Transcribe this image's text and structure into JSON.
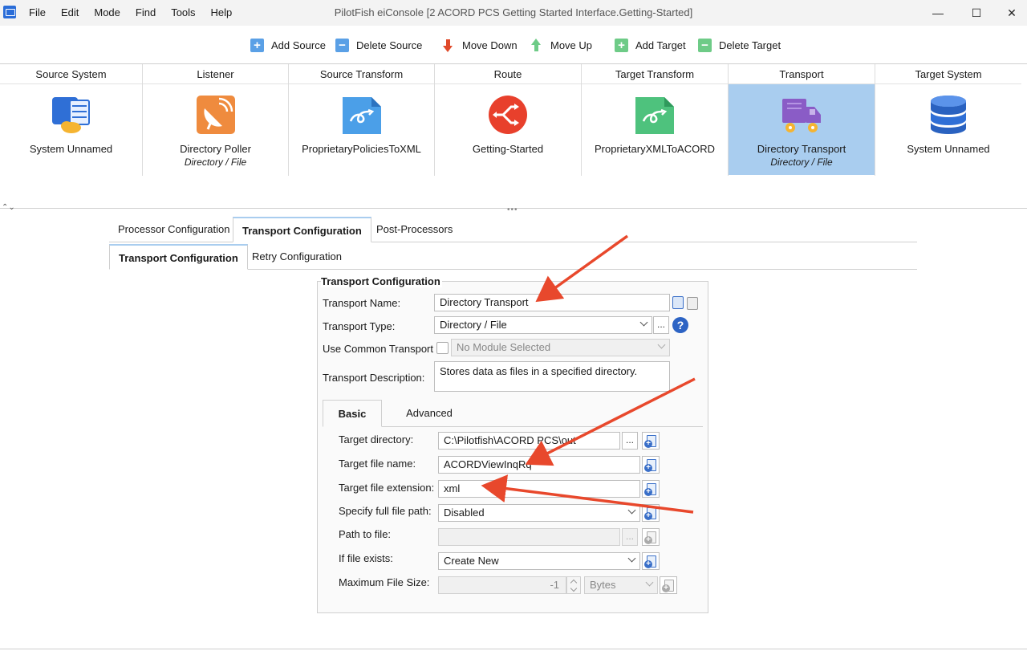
{
  "window": {
    "title": "PilotFish eiConsole [2 ACORD PCS Getting Started Interface.Getting-Started]",
    "minimize": "—",
    "maximize": "☐",
    "close": "✕"
  },
  "menu": [
    "File",
    "Edit",
    "Mode",
    "Find",
    "Tools",
    "Help"
  ],
  "toolbar": {
    "add_source": "Add Source",
    "delete_source": "Delete Source",
    "move_down": "Move Down",
    "move_up": "Move Up",
    "add_target": "Add Target",
    "delete_target": "Delete Target"
  },
  "stages": [
    {
      "header": "Source System",
      "name": "System Unnamed",
      "sub": "",
      "icon": "source-system-icon"
    },
    {
      "header": "Listener",
      "name": "Directory Poller",
      "sub": "Directory / File",
      "icon": "satellite-dish-icon"
    },
    {
      "header": "Source Transform",
      "name": "ProprietaryPoliciesToXML",
      "sub": "",
      "icon": "transform-document-icon"
    },
    {
      "header": "Route",
      "name": "Getting-Started",
      "sub": "",
      "icon": "route-icon"
    },
    {
      "header": "Target Transform",
      "name": "ProprietaryXMLToACORD",
      "sub": "",
      "icon": "transform-document-icon"
    },
    {
      "header": "Transport",
      "name": "Directory Transport",
      "sub": "Directory / File",
      "icon": "truck-icon",
      "selected": true
    },
    {
      "header": "Target System",
      "name": "System Unnamed",
      "sub": "",
      "icon": "database-icon"
    }
  ],
  "tabs_outer": [
    "Processor Configuration",
    "Transport Configuration",
    "Post-Processors"
  ],
  "tabs_inner": [
    "Transport Configuration",
    "Retry Configuration"
  ],
  "panel": {
    "title": "Transport Configuration",
    "transport_name_label": "Transport Name:",
    "transport_name_value": "Directory  Transport",
    "transport_type_label": "Transport Type:",
    "transport_type_value": "Directory / File",
    "use_common_label": "Use Common Transport",
    "use_common_value": "No Module Selected",
    "description_label": "Transport Description:",
    "description_value": "Stores data as files in a specified directory.",
    "ellipsis": "...",
    "help": "?"
  },
  "subtabs": [
    "Basic",
    "Advanced"
  ],
  "basic": {
    "target_directory_label": "Target directory:",
    "target_directory_value": "C:\\Pilotfish\\ACORD PCS\\out",
    "target_file_name_label": "Target file name:",
    "target_file_name_value": "ACORDViewInqRq",
    "target_file_ext_label": "Target file extension:",
    "target_file_ext_value": "xml",
    "full_path_label": "Specify full file path:",
    "full_path_value": "Disabled",
    "path_to_file_label": "Path to file:",
    "path_to_file_value": "",
    "if_exists_label": "If file exists:",
    "if_exists_value": "Create New",
    "max_size_label": "Maximum File Size:",
    "max_size_value": "-1",
    "max_size_unit": "Bytes"
  },
  "colors": {
    "selected_stage": "#a9cdef",
    "annotation_arrow": "#e8482c"
  }
}
